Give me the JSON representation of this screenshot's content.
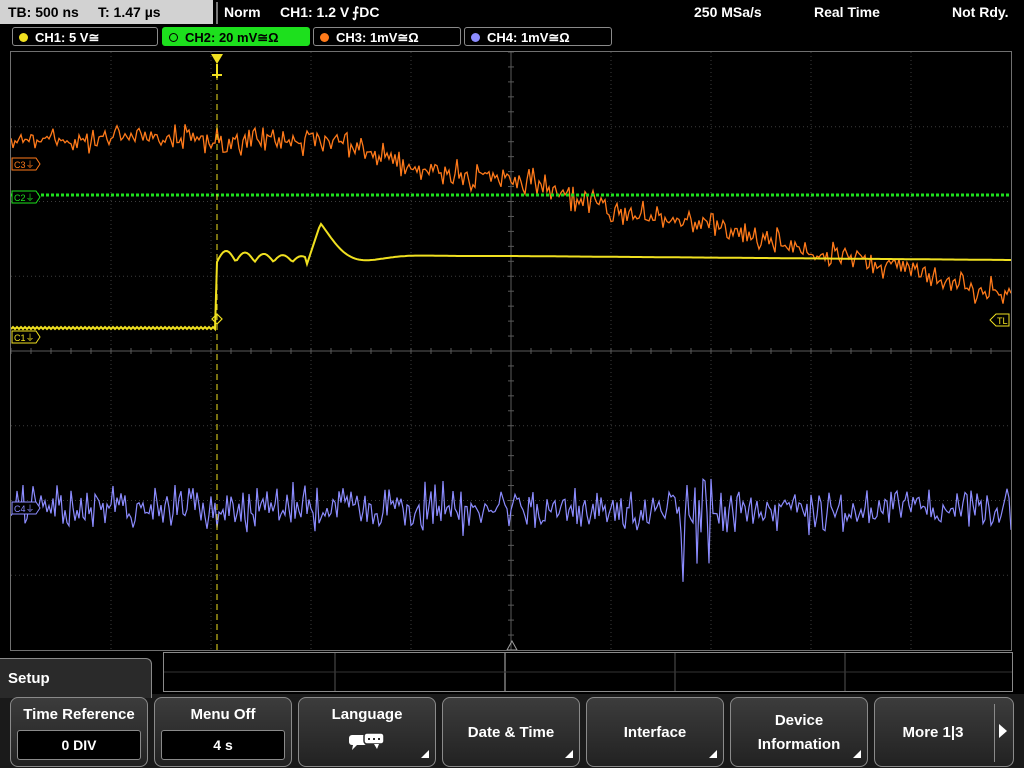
{
  "topbar": {
    "timebase": "TB: 500 ns",
    "trigger_time": "T: 1.47 µs",
    "mode": "Norm",
    "trigger_source": "CH1: 1.2 V",
    "trigger_edge": "⨍DC",
    "sample_rate": "250 MSa/s",
    "acq_mode": "Real Time",
    "status": "Not Rdy."
  },
  "channels": [
    {
      "label": "CH1: 5 V≅",
      "color": "#f0e020",
      "active": false
    },
    {
      "label": "CH2: 20 mV≅Ω",
      "color": "#1de01d",
      "active": true
    },
    {
      "label": "CH3: 1mV≅Ω",
      "color": "#ff7a1a",
      "active": false
    },
    {
      "label": "CH4: 1mV≅Ω",
      "color": "#8c8cff",
      "active": false
    }
  ],
  "screen": {
    "markers": {
      "c3": "C3⏚",
      "c2": "C2⏚",
      "c1": "C1⏚",
      "c4": "C4⏚",
      "trigger_level": "TL"
    }
  },
  "menu": {
    "title": "Setup",
    "softkeys": [
      {
        "name": "time-reference",
        "label": "Time Reference",
        "value": "0 DIV"
      },
      {
        "name": "menu-off",
        "label": "Menu Off",
        "value": "4 s"
      },
      {
        "name": "language",
        "label": "Language"
      },
      {
        "name": "date-time",
        "label": "Date & Time"
      },
      {
        "name": "interface",
        "label": "Interface"
      },
      {
        "name": "device-information",
        "label_line1": "Device",
        "label_line2": "Information"
      },
      {
        "name": "more",
        "label": "More 1|3"
      }
    ]
  },
  "colors": {
    "ch1": "#f0e020",
    "ch2": "#1de01d",
    "ch3": "#ff7a1a",
    "ch4": "#8c8cff",
    "grid": "#4a4a4a"
  }
}
